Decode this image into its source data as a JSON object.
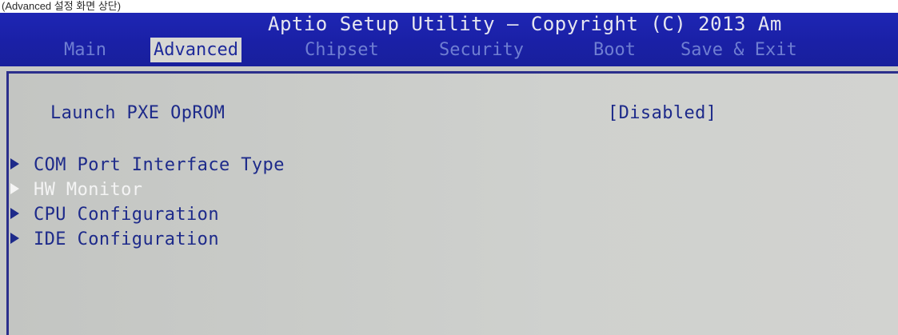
{
  "caption": "(Advanced 설정 화면 상단)",
  "header": {
    "title": "Aptio Setup Utility – Copyright (C) 2013 Am",
    "tabs": [
      {
        "label": "Main"
      },
      {
        "label": "Advanced"
      },
      {
        "label": "Chipset"
      },
      {
        "label": "Security"
      },
      {
        "label": "Boot"
      },
      {
        "label": "Save & Exit"
      }
    ],
    "active_tab": "Advanced"
  },
  "settings": {
    "launch_pxe": {
      "label": "Launch PXE OpROM",
      "value": "[Disabled]"
    },
    "submenus": [
      {
        "label": "COM Port Interface Type",
        "icon": "triangle-right-icon"
      },
      {
        "label": "HW Monitor",
        "icon": "triangle-right-icon"
      },
      {
        "label": "CPU Configuration",
        "icon": "triangle-right-icon"
      },
      {
        "label": "IDE Configuration",
        "icon": "triangle-right-icon"
      }
    ],
    "selected_submenu": "HW Monitor"
  },
  "colors": {
    "header_bg": "#1e26b4",
    "active_tab_bg": "#d7d7d3",
    "body_bg": "#c7c9c6",
    "text_blue": "#1d2a8a",
    "selected_text": "#f4f4f4"
  }
}
